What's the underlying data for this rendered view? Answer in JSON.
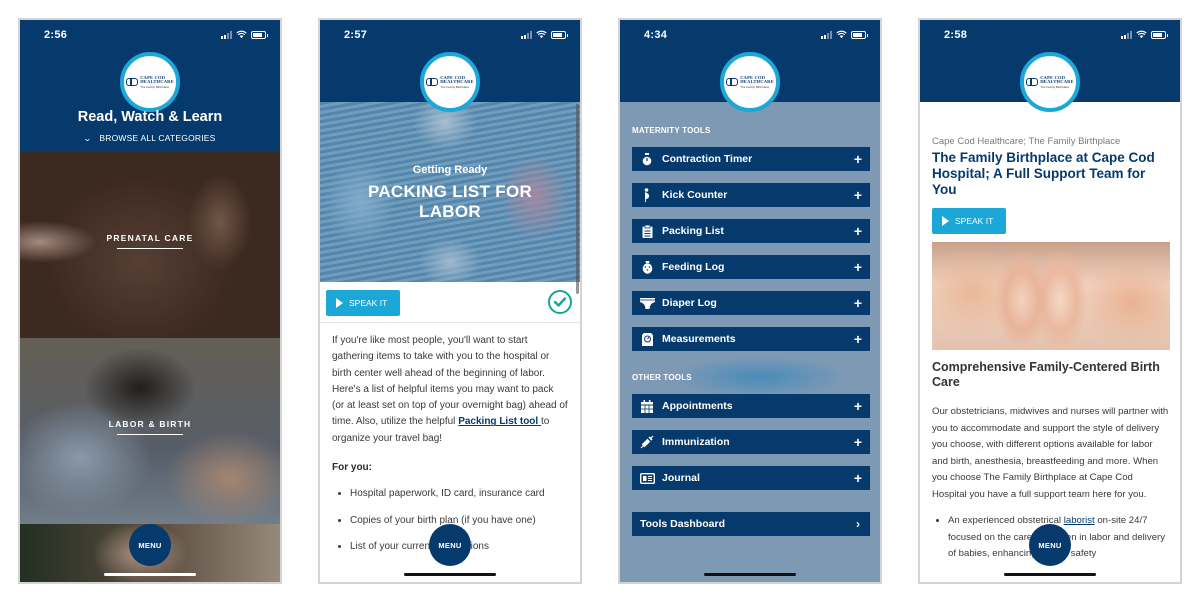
{
  "colors": {
    "navy": "#063a6d",
    "cyan": "#1ba7d8",
    "teal_check": "#17a59a",
    "menu_overlay": "#7e99b4"
  },
  "brand": {
    "logo_line1": "CAPE COD",
    "logo_line2": "HEALTHCARE",
    "logo_tagline": "The Family Birthplace"
  },
  "menu_fab_label": "MENU",
  "screens": [
    {
      "status_time": "2:56",
      "nav_left_icon": "plus-icon",
      "nav_right_icon": "search-icon",
      "title": "Read, Watch & Learn",
      "browse_label": "BROWSE ALL CATEGORIES",
      "categories": [
        {
          "label": "PRENATAL CARE"
        },
        {
          "label": "LABOR & BIRTH"
        },
        {
          "label": ""
        }
      ]
    },
    {
      "status_time": "2:57",
      "nav_left_icon": "back-chevron-icon",
      "nav_right_icon": "search-icon",
      "eyebrow": "Getting Ready",
      "headline": "PACKING LIST FOR LABOR",
      "speak_label": "SPEAK IT",
      "intro_before_link": "If you're like most people, you'll want to start gathering items to take with you to the hospital or birth center well ahead of the beginning of labor. Here's a list of helpful items you may want to pack (or at least set on top of your overnight bag) ahead of time. Also, utilize the helpful ",
      "intro_link": "Packing List tool ",
      "intro_after_link": "to organize your travel bag!",
      "for_you_heading": "For you:",
      "for_you_items": [
        "Hospital paperwork, ID card, insurance card",
        "Copies of your birth plan (if you have one)",
        "List of your current medications"
      ]
    },
    {
      "status_time": "4:34",
      "nav_left_icon": "close-icon",
      "maternity_heading": "MATERNITY TOOLS",
      "maternity_tools": [
        {
          "label": "Contraction Timer",
          "icon": "stopwatch-icon"
        },
        {
          "label": "Kick Counter",
          "icon": "pregnant-icon"
        },
        {
          "label": "Packing List",
          "icon": "clipboard-icon"
        },
        {
          "label": "Feeding Log",
          "icon": "bottle-icon"
        },
        {
          "label": "Diaper Log",
          "icon": "diaper-icon"
        },
        {
          "label": "Measurements",
          "icon": "scale-icon"
        }
      ],
      "other_heading": "OTHER TOOLS",
      "other_tools": [
        {
          "label": "Appointments",
          "icon": "calendar-icon"
        },
        {
          "label": "Immunization",
          "icon": "syringe-icon"
        },
        {
          "label": "Journal",
          "icon": "journal-icon"
        }
      ],
      "dashboard_label": "Tools Dashboard"
    },
    {
      "status_time": "2:58",
      "nav_left_icon": "hamburger-icon",
      "nav_right_icon": "search-icon",
      "eyebrow": "Cape Cod Healthcare; The Family Birthplace",
      "title": "The Family Birthplace at Cape Cod Hospital; A Full Support Team for You",
      "speak_label": "SPEAK IT",
      "subheading": "Comprehensive Family-Centered Birth Care",
      "paragraph": "Our obstetricians, midwives and nurses will partner with you to accommodate and support the style of delivery you choose, with different options available for labor and birth, anesthesia, breastfeeding and more. When you choose The Family Birthplace at Cape Cod Hospital you have a full support team here for you.",
      "bullet_before_link": "An experienced obstetrical ",
      "bullet_link": "laborist",
      "bullet_after_link": " on-site 24/7 focused on the care of women in labor and delivery of babies, enhancing patient safety"
    }
  ]
}
